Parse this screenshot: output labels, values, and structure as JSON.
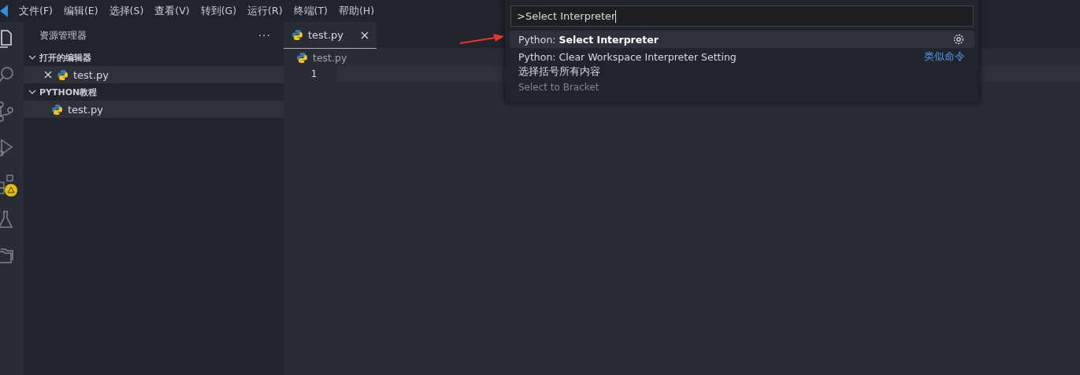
{
  "menu_bar": [
    "文件(F)",
    "编辑(E)",
    "选择(S)",
    "查看(V)",
    "转到(G)",
    "运行(R)",
    "终端(T)",
    "帮助(H)"
  ],
  "activity_bar": [
    {
      "kind": "files",
      "selected": true
    },
    {
      "kind": "search",
      "selected": false
    },
    {
      "kind": "branch",
      "selected": false
    },
    {
      "kind": "run",
      "selected": false
    },
    {
      "kind": "extensions",
      "selected": false,
      "warning": true
    },
    {
      "kind": "flask",
      "selected": false
    },
    {
      "kind": "folders",
      "selected": false
    }
  ],
  "sidebar": {
    "title": "资源管理器",
    "more": "···",
    "sections": [
      {
        "title": "打开的编辑器",
        "expanded": true,
        "items": [
          {
            "label": "test.py",
            "selected": true,
            "closable": true
          }
        ]
      },
      {
        "title": "PYTHON教程",
        "expanded": true,
        "items": [
          {
            "label": "test.py",
            "selected": true,
            "closable": false
          }
        ]
      }
    ]
  },
  "tabs": [
    {
      "label": "test.py",
      "selected": true
    }
  ],
  "breadcrumb": "test.py",
  "editor": {
    "lines": [
      "1"
    ]
  },
  "command_palette": {
    "value": ">Select Interpreter",
    "items": [
      {
        "label": "Python: **Select Interpreter**",
        "selected": true,
        "gear": true
      },
      {
        "label": "Python: Clear Workspace Interpreter Setting",
        "selected": false,
        "aside": "类似命令"
      },
      {
        "label": "选择括号所有内容",
        "selected": false,
        "detail": "Select to Bracket"
      }
    ]
  },
  "annotation": {
    "arrow": true
  }
}
